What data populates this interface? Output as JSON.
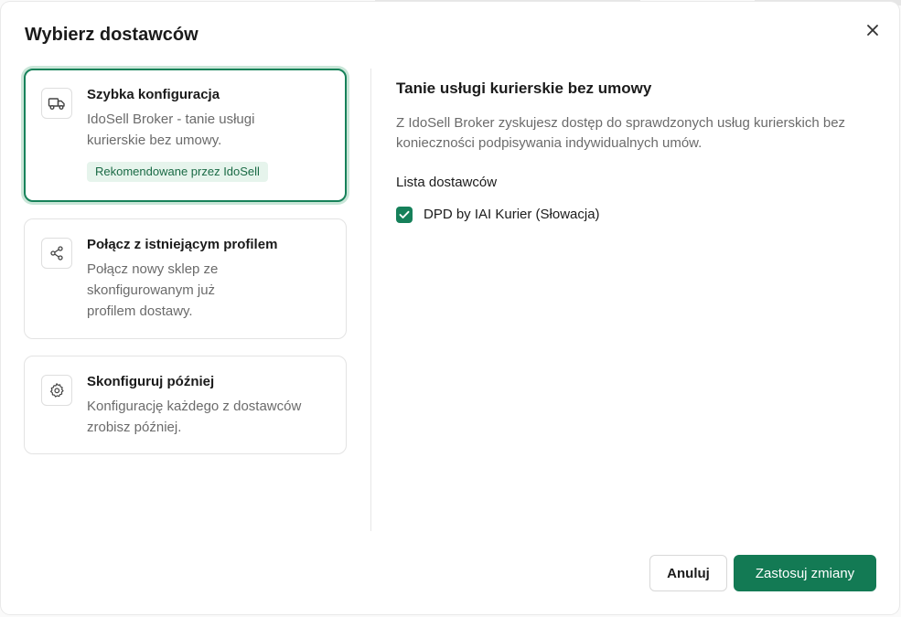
{
  "dialog": {
    "title": "Wybierz dostawców",
    "close_icon": "close-icon"
  },
  "options": [
    {
      "title": "Szybka konfiguracja",
      "description": "IdoSell Broker - tanie usługi kurierskie bez umowy.",
      "badge": "Rekomendowane przez IdoSell",
      "icon": "truck-icon",
      "selected": true
    },
    {
      "title": "Połącz z istniejącym profilem",
      "description": "Połącz nowy sklep ze skonfigurowanym już profilem dostawy.",
      "icon": "share-icon",
      "selected": false
    },
    {
      "title": "Skonfiguruj później",
      "description": "Konfigurację każdego z dostawców zrobisz później.",
      "icon": "gear-icon",
      "selected": false
    }
  ],
  "detail": {
    "title": "Tanie usługi kurierskie bez umowy",
    "description": "Z IdoSell Broker zyskujesz dostęp do sprawdzonych usług kurierskich bez konieczności podpisywania indywidualnych umów.",
    "list_label": "Lista dostawców",
    "providers": [
      {
        "name": "DPD by IAI Kurier (Słowacja)",
        "checked": true
      }
    ]
  },
  "footer": {
    "cancel_label": "Anuluj",
    "apply_label": "Zastosuj zmiany"
  },
  "colors": {
    "accent": "#137a54",
    "badge_bg": "#e6f4ec",
    "badge_text": "#1a6a45"
  }
}
